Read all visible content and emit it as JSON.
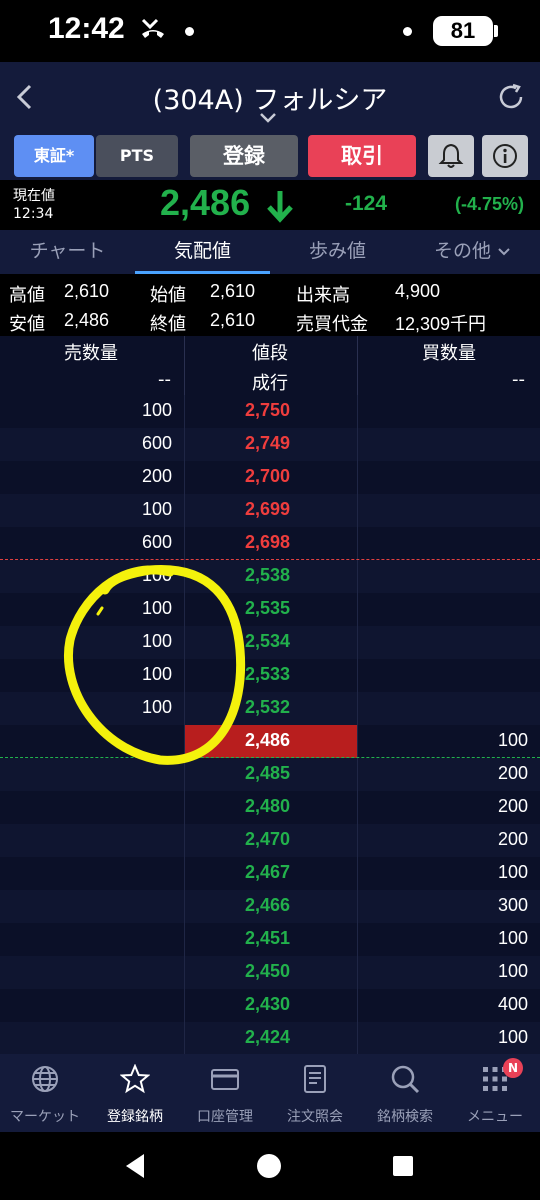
{
  "status_bar": {
    "time": "12:42",
    "battery": "81"
  },
  "header": {
    "title": "(304A) フォルシア"
  },
  "toolbar": {
    "market_tse": "東証*",
    "market_pts": "PTS",
    "register": "登録",
    "trade": "取引",
    "colors": {
      "tse_active": "#5e8ff3",
      "trade": "#e94157"
    }
  },
  "quote": {
    "label": "現在値",
    "time": "12:34",
    "price": "2,486",
    "change": "-124",
    "change_pct": "(-4.75%)",
    "direction_icon": "arrow-down-icon",
    "color": "#22b14c"
  },
  "tabs": [
    {
      "label": "チャート"
    },
    {
      "label": "気配値"
    },
    {
      "label": "歩み値"
    },
    {
      "label": "その他"
    }
  ],
  "stats": {
    "high_label": "高値",
    "high": "2,610",
    "open_label": "始値",
    "open": "2,610",
    "volume_label": "出来高",
    "volume": "4,900",
    "low_label": "安値",
    "low": "2,486",
    "close_label": "終値",
    "close": "2,610",
    "turnover_label": "売買代金",
    "turnover": "12,309千円"
  },
  "board": {
    "headers": {
      "ask_qty": "売数量",
      "price": "値段",
      "bid_qty": "買数量"
    },
    "market_order": {
      "ask": "--",
      "price": "成行",
      "bid": "--"
    },
    "rows": [
      {
        "ask": "100",
        "price": "2,750",
        "bid": "",
        "side": "sell"
      },
      {
        "ask": "600",
        "price": "2,749",
        "bid": "",
        "side": "sell"
      },
      {
        "ask": "200",
        "price": "2,700",
        "bid": "",
        "side": "sell"
      },
      {
        "ask": "100",
        "price": "2,699",
        "bid": "",
        "side": "sell"
      },
      {
        "ask": "600",
        "price": "2,698",
        "bid": "",
        "side": "sell"
      },
      {
        "ask": "100",
        "price": "2,538",
        "bid": "",
        "side": "sell-low"
      },
      {
        "ask": "100",
        "price": "2,535",
        "bid": "",
        "side": "sell-low"
      },
      {
        "ask": "100",
        "price": "2,534",
        "bid": "",
        "side": "sell-low"
      },
      {
        "ask": "100",
        "price": "2,533",
        "bid": "",
        "side": "sell-low"
      },
      {
        "ask": "100",
        "price": "2,532",
        "bid": "",
        "side": "sell-low"
      },
      {
        "ask": "",
        "price": "2,486",
        "bid": "100",
        "side": "current"
      },
      {
        "ask": "",
        "price": "2,485",
        "bid": "200",
        "side": "buy"
      },
      {
        "ask": "",
        "price": "2,480",
        "bid": "200",
        "side": "buy"
      },
      {
        "ask": "",
        "price": "2,470",
        "bid": "200",
        "side": "buy"
      },
      {
        "ask": "",
        "price": "2,467",
        "bid": "100",
        "side": "buy"
      },
      {
        "ask": "",
        "price": "2,466",
        "bid": "300",
        "side": "buy"
      },
      {
        "ask": "",
        "price": "2,451",
        "bid": "100",
        "side": "buy"
      },
      {
        "ask": "",
        "price": "2,450",
        "bid": "100",
        "side": "buy"
      },
      {
        "ask": "",
        "price": "2,430",
        "bid": "400",
        "side": "buy"
      },
      {
        "ask": "",
        "price": "2,424",
        "bid": "100",
        "side": "buy"
      }
    ]
  },
  "bottom_nav": [
    {
      "label": "マーケット",
      "icon": "globe-icon"
    },
    {
      "label": "登録銘柄",
      "icon": "star-icon",
      "active": true
    },
    {
      "label": "口座管理",
      "icon": "card-icon"
    },
    {
      "label": "注文照会",
      "icon": "document-icon"
    },
    {
      "label": "銘柄検索",
      "icon": "search-icon"
    },
    {
      "label": "メニュー",
      "icon": "grid-menu-icon",
      "badge": "N"
    }
  ]
}
